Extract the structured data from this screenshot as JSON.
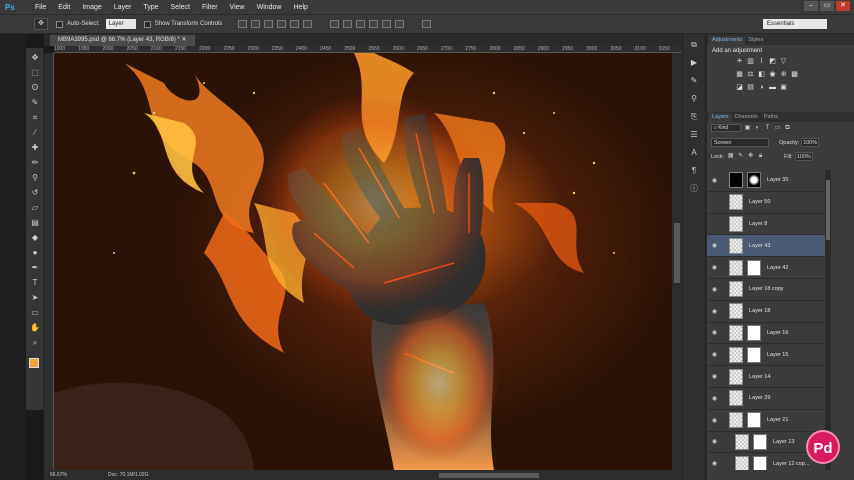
{
  "app": {
    "logo": "Ps",
    "menu": [
      "File",
      "Edit",
      "Image",
      "Layer",
      "Type",
      "Select",
      "Filter",
      "View",
      "Window",
      "Help"
    ],
    "window_buttons": {
      "minimize": "–",
      "restore": "▭",
      "close": "✕"
    }
  },
  "options_bar": {
    "auto_select_label": "Auto-Select:",
    "auto_select_value": "Layer",
    "transform_label": "Show Transform Controls",
    "workspace": "Essentials"
  },
  "document": {
    "tab_title": "MB9A3995.psd @ 66.7% (Layer 43, RGB/8) *",
    "ruler_ticks": [
      "1900",
      "1950",
      "2000",
      "2050",
      "2100",
      "2150",
      "2200",
      "2250",
      "2300",
      "2350",
      "2400",
      "2450",
      "2500",
      "2550",
      "2600",
      "2650",
      "2700",
      "2750",
      "2800",
      "2850",
      "2900",
      "2950",
      "3000",
      "3050",
      "3100",
      "3150",
      "3200",
      "3250",
      "3300",
      "3350",
      "3400",
      "3450",
      "3500",
      "3550",
      "3600",
      "3650",
      "3700",
      "3750",
      "3800",
      "3850",
      "3900",
      "3950"
    ]
  },
  "status_bar": {
    "zoom": "66.67%",
    "doc_info": "Doc: 70.1M/1.02G"
  },
  "adjustments_panel": {
    "tabs": [
      "Adjustments",
      "Styles"
    ],
    "title": "Add an adjustment"
  },
  "layers_panel": {
    "tabs": [
      "Layers",
      "Channels",
      "Paths"
    ],
    "filter_kind": "Kind",
    "blend_mode": "Screen",
    "opacity_label": "Opacity:",
    "opacity_value": "100%",
    "lock_label": "Lock:",
    "fill_label": "Fill:",
    "fill_value": "100%",
    "layers": [
      {
        "name": "Layer 35",
        "visible": true,
        "mask": true,
        "thumb": "black"
      },
      {
        "name": "Layer 50",
        "visible": false,
        "mask": false,
        "thumb": "checker"
      },
      {
        "name": "Layer 8",
        "visible": false,
        "mask": false,
        "thumb": "checker"
      },
      {
        "name": "Layer 43",
        "visible": true,
        "mask": false,
        "thumb": "checker",
        "selected": true
      },
      {
        "name": "Layer 42",
        "visible": true,
        "mask": true,
        "thumb": "checker"
      },
      {
        "name": "Layer 18 copy",
        "visible": true,
        "mask": false,
        "thumb": "checker"
      },
      {
        "name": "Layer 18",
        "visible": true,
        "mask": false,
        "thumb": "checker"
      },
      {
        "name": "Layer 16",
        "visible": true,
        "mask": true,
        "thumb": "checker"
      },
      {
        "name": "Layer 15",
        "visible": true,
        "mask": true,
        "thumb": "checker"
      },
      {
        "name": "Layer 14",
        "visible": true,
        "mask": false,
        "thumb": "checker"
      },
      {
        "name": "Layer 29",
        "visible": true,
        "mask": false,
        "thumb": "checker"
      },
      {
        "name": "Layer 21",
        "visible": true,
        "mask": true,
        "thumb": "checker"
      },
      {
        "name": "Layer 13",
        "visible": true,
        "mask": true,
        "thumb": "checker",
        "indent": true
      },
      {
        "name": "Layer 12 cop...",
        "visible": true,
        "mask": true,
        "thumb": "checker",
        "indent": true
      }
    ]
  },
  "watermark": "Pd",
  "colors": {
    "foreground": "#f7a23b",
    "background": "#ffffff",
    "selected_layer": "#4a5a74"
  }
}
